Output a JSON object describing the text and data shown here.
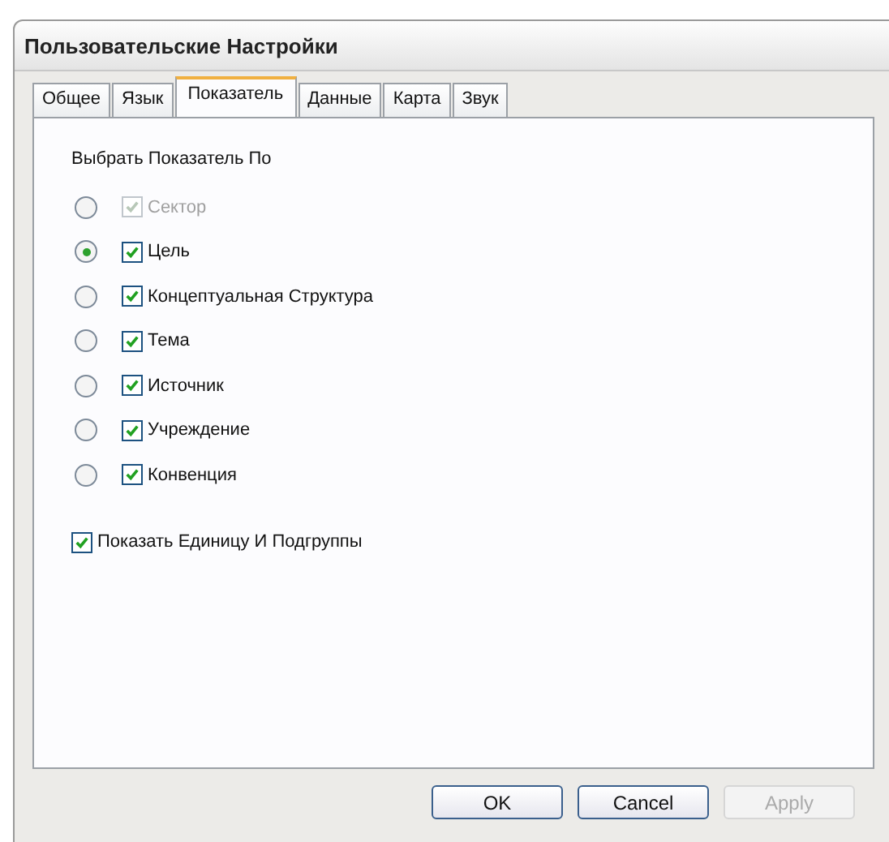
{
  "window": {
    "title": "Пользовательские Настройки"
  },
  "tabs": [
    {
      "label": "Общее",
      "selected": false
    },
    {
      "label": "Язык",
      "selected": false
    },
    {
      "label": "Показатель",
      "selected": true
    },
    {
      "label": "Данные",
      "selected": false
    },
    {
      "label": "Карта",
      "selected": false
    },
    {
      "label": "Звук",
      "selected": false
    }
  ],
  "heading": "Выбрать Показатель По",
  "options": [
    {
      "label": "Сектор",
      "selected": false,
      "checked": true,
      "disabled": true
    },
    {
      "label": "Цель",
      "selected": true,
      "checked": true,
      "disabled": false
    },
    {
      "label": "Концептуальная Структура",
      "selected": false,
      "checked": true,
      "disabled": false
    },
    {
      "label": "Тема",
      "selected": false,
      "checked": true,
      "disabled": false
    },
    {
      "label": "Источник",
      "selected": false,
      "checked": true,
      "disabled": false
    },
    {
      "label": "Учреждение",
      "selected": false,
      "checked": true,
      "disabled": false
    },
    {
      "label": "Конвенция",
      "selected": false,
      "checked": true,
      "disabled": false
    }
  ],
  "show_units": {
    "label": "Показать Единицу И Подгруппы",
    "checked": true
  },
  "buttons": [
    {
      "label": "OK",
      "disabled": false
    },
    {
      "label": "Cancel",
      "disabled": false
    },
    {
      "label": "Apply",
      "disabled": true
    }
  ]
}
